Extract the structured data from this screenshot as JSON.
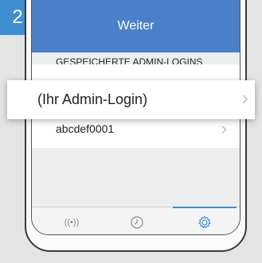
{
  "step_number": "2",
  "header": {
    "title": "Weiter"
  },
  "section_label": "GESPEICHERTE ADMIN-LOGINS",
  "logins": [
    {
      "label": "(Ihr Admin-Login)"
    },
    {
      "label": "abcdef0001"
    }
  ],
  "tabs": [
    {
      "icon": "wifi-signal-icon",
      "glyph": "((•))"
    },
    {
      "icon": "clock-icon"
    },
    {
      "icon": "gear-icon",
      "active": true
    }
  ],
  "colors": {
    "accent": "#3e8ed1",
    "header": "#4a80c7"
  }
}
